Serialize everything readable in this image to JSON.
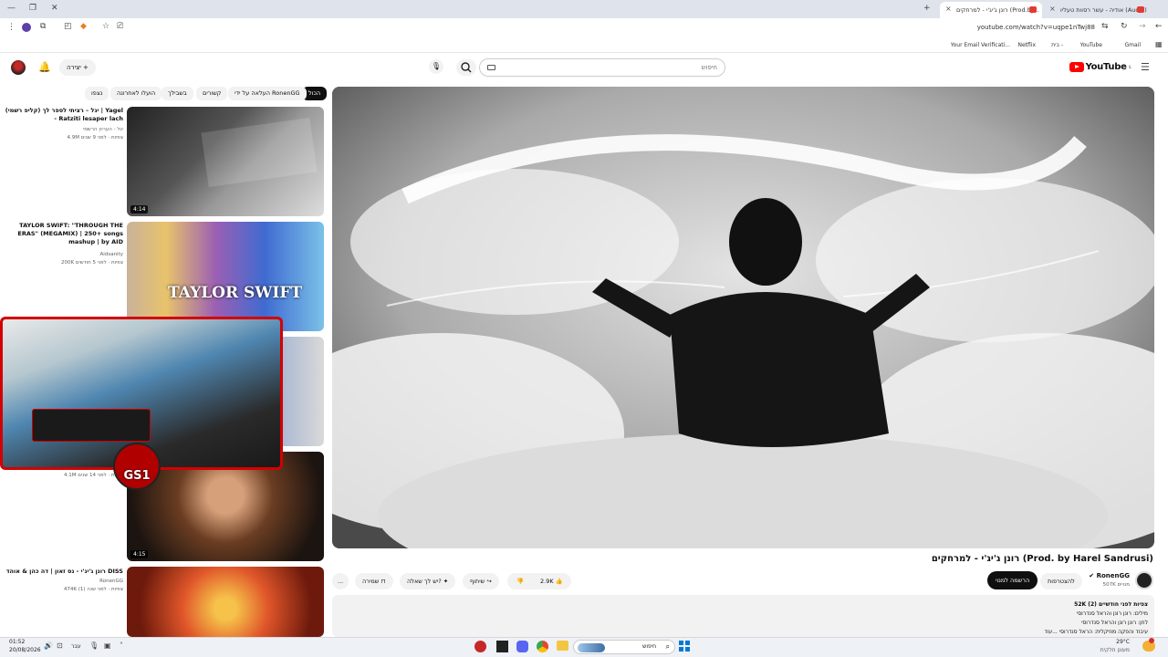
{
  "browser": {
    "tabs": [
      {
        "label": "אודיה - עשר רסוות טעליו (Audio)"
      },
      {
        "label": "רונן ג'יג'י - למרחקים (Prod.by..."
      }
    ],
    "url": "youtube.com/watch?v=uqpe1nTwj88",
    "bookmarks": [
      "Gmail",
      "YouTube",
      "בית -",
      "Netflix",
      "Your Email Verificati..."
    ]
  },
  "header": {
    "logo": "YouTube",
    "logo_sup": "IL",
    "search_placeholder": "חיפוש",
    "create_label": "יצירה"
  },
  "chips": [
    "הכול",
    "העלאה על ידי RonenGG",
    "קשורים",
    "בשבילך",
    "הועלו לאחרונה",
    "נצפו"
  ],
  "related": [
    {
      "title": "יגל – רציתי לספר לך (קליפ רשמי) | Yagel - Ratziti lesaper lach",
      "channel": "יגל - הערוץ הרשמי",
      "meta": "4.9M צפיות · לפני 9 שנים",
      "duration": "4:14"
    },
    {
      "title": "TAYLOR SWIFT: \"THROUGH THE ERAS\" (MEGAMIX) | 250+ songs mashup | by AID",
      "channel": "Aidsanity",
      "meta": "200K צפיות · לפני 5 חודשים",
      "duration": ""
    },
    {
      "title": "",
      "channel": "",
      "meta": "4.1M צפיות · לפני 14 שנים",
      "duration": "4:15"
    },
    {
      "title": "רונן ג'יג'י - נס זאון | דה כהן & אוהד DISS",
      "channel": "RonenGG",
      "meta": "474K צפיות · לפני שנה (1)",
      "duration": ""
    }
  ],
  "overlay": {
    "badge": "GS1"
  },
  "video": {
    "title": "רונן ג'יג'י - למרחקים (Prod. by Harel Sandrusi)",
    "channel": "RonenGG",
    "subs": "507K מנויים",
    "subscribe": "הרשמה למנוי",
    "join": "להצטרפות",
    "likes": "2.9K",
    "share": "שיתוף",
    "ask": "יש לך שאלה?",
    "save": "שמירה",
    "more": "...",
    "desc_stats": "52K צפיות  לפני חודשיים (2)",
    "desc_line1": "מילים: רונן רונן והראל סנדרוסי",
    "desc_line2": "לחן: רונן רונן והראל סנדרוסי",
    "desc_line3": "עיבוד והפקה מוזיקלית: הראל סנדרוסי ...עוד"
  },
  "taskbar": {
    "time": "01:52",
    "date": "20/08/2026",
    "search": "חיפוש",
    "weather_temp": "29°C",
    "weather_desc": "מעונן חלקית",
    "lang": "עבר"
  }
}
